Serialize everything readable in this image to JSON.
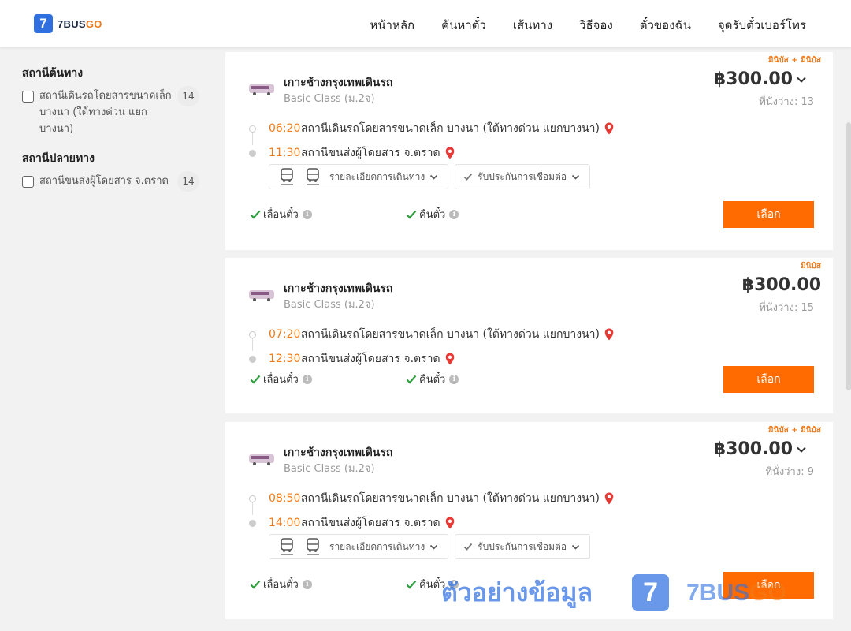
{
  "header": {
    "logo_mark": "7",
    "logo_text": "7BUS",
    "logo_text_go": "GO",
    "nav": [
      "หน้าหลัก",
      "ค้นหาตั๋ว",
      "เส้นทาง",
      "วิธีจอง",
      "ตั๋วของฉัน",
      "จุดรับตั๋วเบอร์โทร"
    ]
  },
  "sidebar": {
    "origin_title": "สถานีต้นทาง",
    "origin_items": [
      {
        "label": "สถานีเดินรถโดยสารขนาดเล็ก บางนา (ใต้ทางด่วน แยกบางนา)",
        "count": "14"
      }
    ],
    "dest_title": "สถานีปลายทาง",
    "dest_items": [
      {
        "label": "สถานีขนส่งผู้โดยสาร จ.ตราด",
        "count": "14"
      }
    ]
  },
  "labels": {
    "route_details": "รายละเอียดการเดินทาง",
    "connection_guarantee": "รับประกันการเชื่อมต่อ",
    "reschedule": "เลื่อนตั๋ว",
    "refund": "คืนตั๋ว",
    "select": "เลือก",
    "info_i": "i"
  },
  "trips": [
    {
      "badge": "มินิบัส + มินิบัส",
      "operator": "เกาะช้างกรุงเทพเดินรถ",
      "class": "Basic Class (ม.2จ)",
      "price": "฿300.00",
      "seats": "ที่นั่งว่าง: 13",
      "depart_time": "06:20",
      "depart_place": "สถานีเดินรถโดยสารขนาดเล็ก บางนา (ใต้ทางด่วน แยกบางนา)",
      "arrive_time": "11:30",
      "arrive_place": "สถานีขนส่งผู้โดยสาร จ.ตราด"
    },
    {
      "badge": "มินิบัส",
      "operator": "เกาะช้างกรุงเทพเดินรถ",
      "class": "Basic Class (ม.2จ)",
      "price": "฿300.00",
      "seats": "ที่นั่งว่าง: 15",
      "depart_time": "07:20",
      "depart_place": "สถานีเดินรถโดยสารขนาดเล็ก บางนา (ใต้ทางด่วน แยกบางนา)",
      "arrive_time": "12:30",
      "arrive_place": "สถานีขนส่งผู้โดยสาร จ.ตราด"
    },
    {
      "badge": "มินิบัส + มินิบัส",
      "operator": "เกาะช้างกรุงเทพเดินรถ",
      "class": "Basic Class (ม.2จ)",
      "price": "฿300.00",
      "seats": "ที่นั่งว่าง: 9",
      "depart_time": "08:50",
      "depart_place": "สถานีเดินรถโดยสารขนาดเล็ก บางนา (ใต้ทางด่วน แยกบางนา)",
      "arrive_time": "14:00",
      "arrive_place": "สถานีขนส่งผู้โดยสาร จ.ตราด"
    }
  ],
  "watermark": {
    "text": "ตัวอย่างข้อมูล",
    "logo_mark": "7",
    "brand": "7BUS",
    "brand_go": "GO"
  },
  "colors": {
    "accent": "#ff6b00",
    "brand_blue": "#2f6fe0",
    "time_orange": "#f07a18",
    "pin_red": "#e53935",
    "check_green": "#2e9e3e"
  }
}
